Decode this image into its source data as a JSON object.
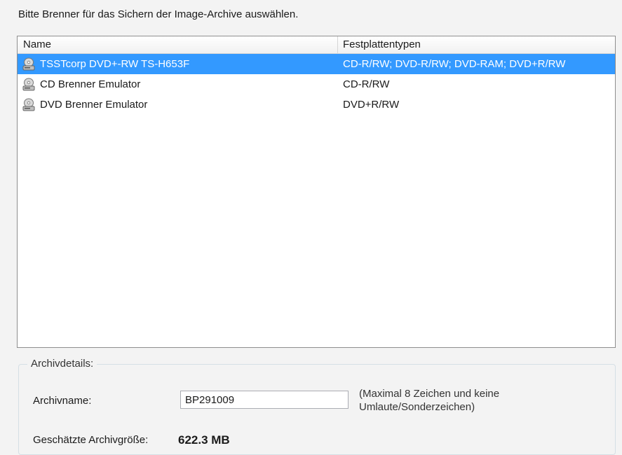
{
  "instruction": "Bitte Brenner für das Sichern der Image-Archive auswählen.",
  "table": {
    "columns": [
      "Name",
      "Festplattentypen"
    ],
    "rows": [
      {
        "name": "TSSTcorp DVD+-RW TS-H653F",
        "types": "CD-R/RW; DVD-R/RW; DVD-RAM; DVD+R/RW",
        "selected": true,
        "icon": "optical-drive-icon"
      },
      {
        "name": "CD Brenner Emulator",
        "types": "CD-R/RW",
        "selected": false,
        "icon": "optical-drive-icon"
      },
      {
        "name": "DVD Brenner Emulator",
        "types": "DVD+R/RW",
        "selected": false,
        "icon": "optical-drive-icon"
      }
    ]
  },
  "details": {
    "title": "Archivdetails:",
    "archive_name_label": "Archivname:",
    "archive_name_value": "BP291009",
    "hint_line1": "(Maximal 8 Zeichen und keine",
    "hint_line2": "Umlaute/Sonderzeichen)",
    "size_label": "Geschätzte Archivgröße:",
    "size_value": "622.3 MB"
  },
  "colors": {
    "selection": "#3399ff",
    "background": "#f3f3f3"
  }
}
